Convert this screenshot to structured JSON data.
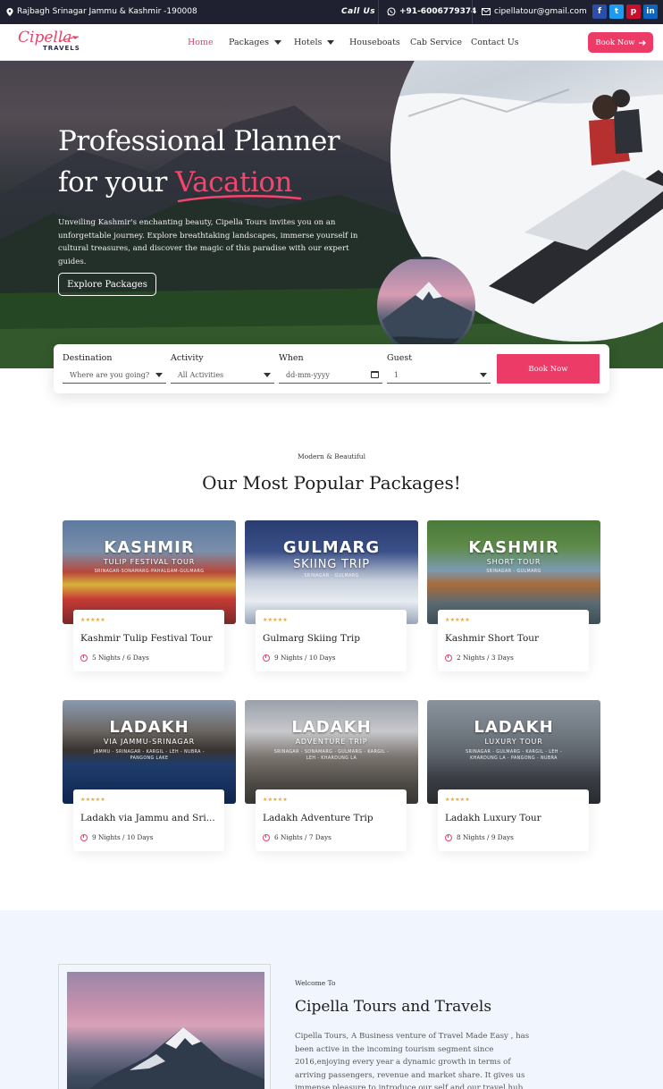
{
  "topbar": {
    "address": "Rajbagh Srinagar Jammu & Kashmir -190008",
    "call_label": "Call Us",
    "phone": "+91-6006779374",
    "email": "cipellatour@gmail.com",
    "social": [
      "f",
      "t",
      "p",
      "in"
    ],
    "social_colors": [
      "#2b4ea8",
      "#1d9bf0",
      "#c8102e",
      "#0a66c2"
    ]
  },
  "logo": {
    "script": "Cipella",
    "word": "TRAVELS"
  },
  "nav": {
    "items": [
      {
        "label": "Home"
      },
      {
        "label": "Packages"
      },
      {
        "label": "Hotels"
      },
      {
        "label": "Houseboats"
      },
      {
        "label": "Cab Service"
      },
      {
        "label": "Contact Us"
      }
    ],
    "book_label": "Book Now",
    "accent": "#ed3b68"
  },
  "hero": {
    "line1": "Professional Planner",
    "line2_prefix": "for your",
    "line2_accent": "Vacation",
    "paragraph": "Unveiling Kashmir's enchanting beauty, Cipella Tours invites you on an unforgettable journey. Explore breathtaking landscapes, immerse yourself in cultural treasures, and discover the magic of this paradise with our expert guides.",
    "cta": "Explore Packages"
  },
  "search": {
    "destination": {
      "label": "Destination",
      "value": "Where are you going?"
    },
    "activity": {
      "label": "Activity",
      "value": "All Activities"
    },
    "when": {
      "label": "When",
      "value": "dd-mm-yyyy"
    },
    "guest": {
      "label": "Guest",
      "value": "1"
    },
    "book_label": "Book Now"
  },
  "packages": {
    "kicker": "Modern & Beautiful",
    "title": "Our Most Popular Packages!",
    "stars": "★★★★★",
    "items": [
      {
        "img_t1": "KASHMIR",
        "img_t2": "TULIP FESTIVAL TOUR",
        "img_t3": "SRINAGAR-SONAMARG-PAHALGAM-GULMARG",
        "title": "Kashmir Tulip Festival Tour",
        "duration": "5 Nights / 6 Days"
      },
      {
        "img_t1": "GULMARG",
        "img_t2": "SKIING TRIP",
        "img_t3": "SRINAGAR - GULMARG",
        "title": "Gulmarg Skiing Trip",
        "duration": "9 Nights / 10 Days"
      },
      {
        "img_t1": "KASHMIR",
        "img_t2": "SHORT TOUR",
        "img_t3": "SRINAGAR - GULMARG",
        "title": "Kashmir Short Tour",
        "duration": "2 Nights / 3 Days"
      },
      {
        "img_t1": "LADAKH",
        "img_t2": "VIA JAMMU-SRINAGAR",
        "img_t3": "JAMMU - SRINAGAR - KARGIL - LEH - NUBRA - PANGONG LAKE",
        "title": "Ladakh via Jammu and Sri...",
        "duration": "9 Nights / 10 Days"
      },
      {
        "img_t1": "LADAKH",
        "img_t2": "ADVENTURE TRIP",
        "img_t3": "SRINAGAR - SONAMARG - GULMARG - KARGIL - LEH - KHARDUNG LA",
        "title": "Ladakh Adventure Trip",
        "duration": "6 Nights / 7 Days"
      },
      {
        "img_t1": "LADAKH",
        "img_t2": "LUXURY TOUR",
        "img_t3": "SRINAGAR - GULMARG - KARGIL - LEH - KHARDUNG LA - PANGONG - NUBRA",
        "title": "Ladakh Luxury Tour",
        "duration": "8 Nights / 9 Days"
      }
    ]
  },
  "about": {
    "kicker": "Welcome To",
    "title": "Cipella Tours and Travels",
    "text": "Cipella Tours, A Business venture of Travel Made Easy , has been active in the incoming tourism segment since 2016,enjoying every year a dynamic growth in terms of arriving passengers, revenue and market share. It gives us immense pleasure to introduce our self and our travel hub “Cipella Tour & Travels”, one of the premier travel"
  }
}
